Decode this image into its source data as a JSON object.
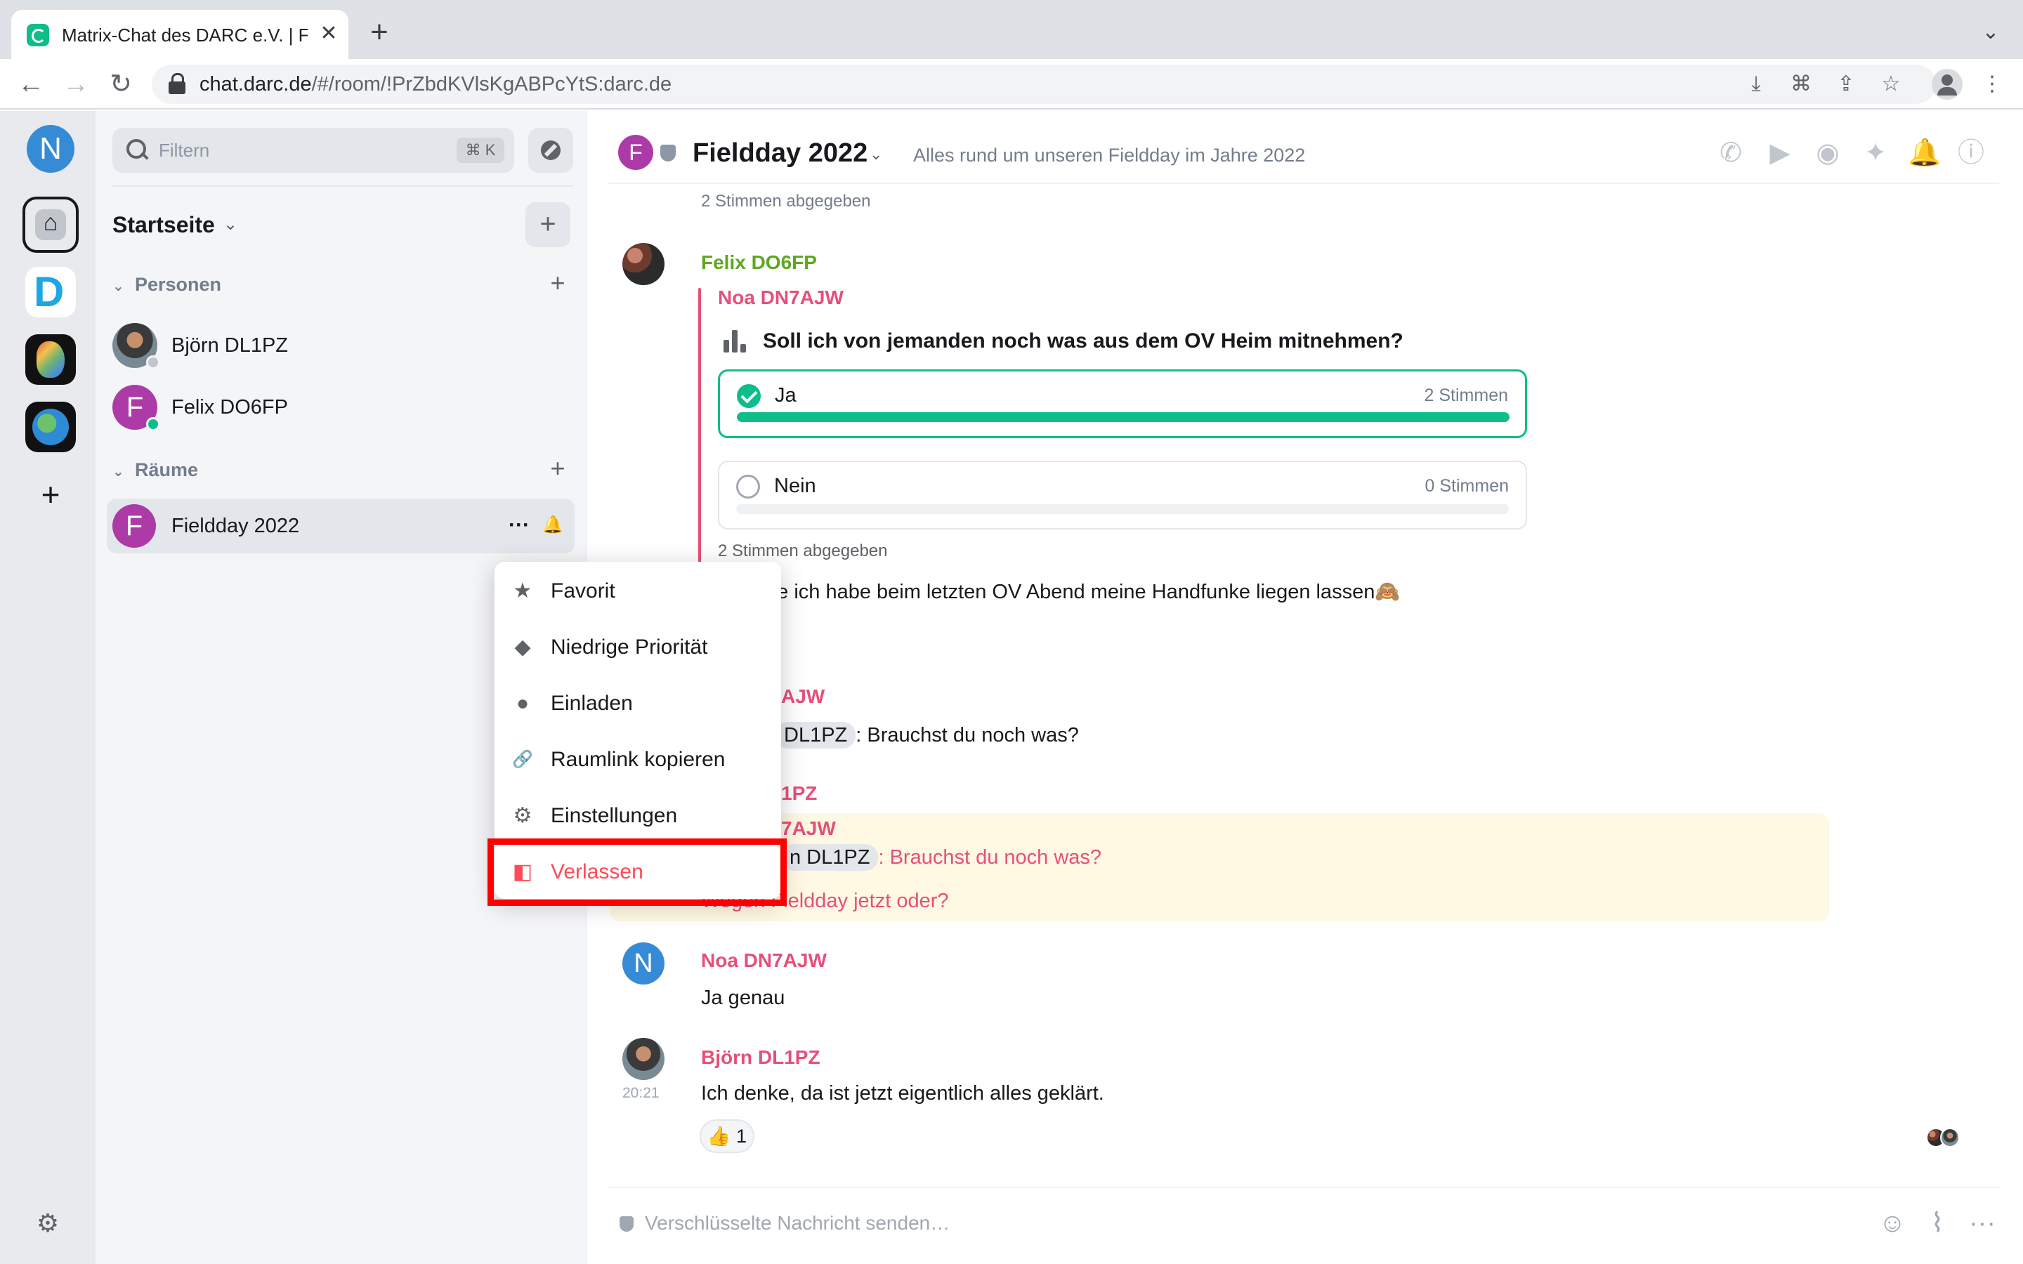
{
  "browser": {
    "tab_title": "Matrix-Chat des DARC e.V. | Fi",
    "tab_close": "✕",
    "new_tab": "+",
    "url_host": "chat.darc.de",
    "url_path": "/#/room/!PrZbdKVlsKgABPcYtS:darc.de"
  },
  "spaces": {
    "user_initial": "N",
    "add": "+"
  },
  "roomlist": {
    "filter_placeholder": "Filtern",
    "filter_shortcut": "⌘ K",
    "home_title": "Startseite",
    "home_chevron": "⌄",
    "home_add": "+",
    "people_header": "Personen",
    "rooms_header": "Räume",
    "people": [
      {
        "name": "Björn DL1PZ"
      },
      {
        "name": "Felix DO6FP",
        "initial": "F"
      }
    ],
    "rooms": [
      {
        "name": "Fieldday 2022",
        "initial": "F",
        "more": "···",
        "bell": "🔔"
      }
    ]
  },
  "room_header": {
    "initial": "F",
    "name": "Fieldday 2022",
    "chevron": "⌄",
    "topic": "Alles rund um unseren Fieldday im Jahre 2022"
  },
  "timeline": {
    "top_votes_summary": "2 Stimmen abgegeben",
    "msg1": {
      "sender": "Felix DO6FP",
      "poll_author": "Noa DN7AJW",
      "poll_question": "Soll ich von jemanden noch was aus dem OV Heim mitnehmen?",
      "options": [
        {
          "label": "Ja",
          "votes": "2 Stimmen",
          "fraction": 1.0,
          "selected": true
        },
        {
          "label": "Nein",
          "votes": "0 Stimmen",
          "fraction": 0.0,
          "selected": false
        }
      ],
      "votes_summary": "2 Stimmen abgegeben",
      "text_tail": "be ich habe beim letzten OV Abend meine Handfunke liegen lassen🙈"
    },
    "msg2": {
      "sender_tail": "AJW",
      "mention_tail": "DL1PZ",
      "text": ": Brauchst du noch was?"
    },
    "msg3": {
      "sender_tail": "1PZ",
      "quote_sender_tail": "7AJW",
      "quote_mention_tail": "n DL1PZ",
      "quote_text": ": Brauchst du noch was?",
      "text_tail": "Wegen Fieldday jetzt oder?"
    },
    "msg4": {
      "initial": "N",
      "sender": "Noa DN7AJW",
      "text": "Ja genau"
    },
    "msg5": {
      "sender": "Björn DL1PZ",
      "time": "20:21",
      "text": "Ich denke, da ist jetzt eigentlich alles geklärt.",
      "reaction": "👍 1"
    }
  },
  "composer": {
    "placeholder": "Verschlüsselte Nachricht senden…",
    "more": "···"
  },
  "context_menu": {
    "items": [
      {
        "label": "Favorit",
        "icon": "★"
      },
      {
        "label": "Niedrige Priorität",
        "icon": "◆"
      },
      {
        "label": "Einladen",
        "icon": "●"
      },
      {
        "label": "Raumlink kopieren",
        "icon": "🔗"
      },
      {
        "label": "Einstellungen",
        "icon": "⚙"
      },
      {
        "label": "Verlassen",
        "icon": "◧"
      }
    ]
  },
  "colors": {
    "accent_green": "#0dbd8b",
    "sender_green": "#5ea820",
    "sender_pink": "#e64f7a",
    "leave_red": "#ff4b55",
    "highlight_box": "#ff0000"
  }
}
